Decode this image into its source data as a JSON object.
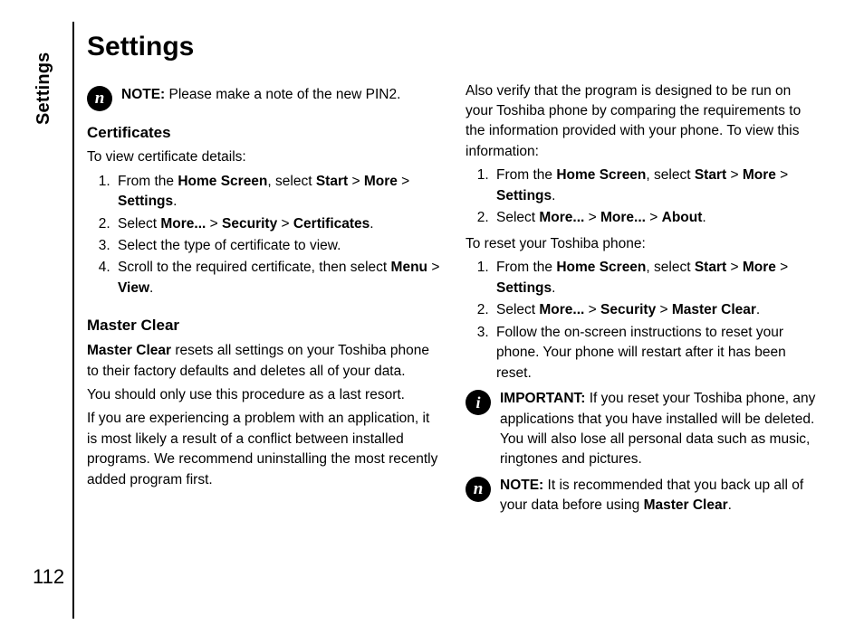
{
  "side_label": "Settings",
  "page_number": "112",
  "title": "Settings",
  "left": {
    "note1": {
      "label": "NOTE:",
      "text": " Please make a note of the new PIN2."
    },
    "certificates": {
      "heading": "Certificates",
      "intro": "To view certificate details:",
      "s1a": "From the ",
      "s1b": "Home Screen",
      "s1c": ", select ",
      "s1d": "Start",
      "s1e": " > ",
      "s1f": "More",
      "s1g": " > ",
      "s1h": "Settings",
      "s1i": ".",
      "s2a": "Select ",
      "s2b": "More...",
      "s2c": " > ",
      "s2d": "Security",
      "s2e": " > ",
      "s2f": "Certificates",
      "s2g": ".",
      "s3": "Select the type of certificate to view.",
      "s4a": "Scroll to the required certificate, then select ",
      "s4b": "Menu",
      "s4c": " > ",
      "s4d": "View",
      "s4e": "."
    },
    "master": {
      "heading": "Master Clear",
      "p1a": "Master Clear",
      "p1b": " resets all settings on your Toshiba phone to their factory defaults and deletes all of your data.",
      "p2": "You should only use this procedure as a last resort.",
      "p3": "If you are experiencing a problem with an application, it is most likely a result of a conflict between installed programs. We recommend uninstalling the most recently added program first."
    }
  },
  "right": {
    "p1": "Also verify that the program is designed to be run on your Toshiba phone by comparing the requirements to the information provided with your phone. To view this information:",
    "info_s1a": "From the ",
    "info_s1b": "Home Screen",
    "info_s1c": ", select ",
    "info_s1d": "Start",
    "info_s1e": " > ",
    "info_s1f": "More",
    "info_s1g": " > ",
    "info_s1h": "Settings",
    "info_s1i": ".",
    "info_s2a": "Select ",
    "info_s2b": "More...",
    "info_s2c": " > ",
    "info_s2d": "More...",
    "info_s2e": " > ",
    "info_s2f": "About",
    "info_s2g": ".",
    "reset_intro": "To reset your Toshiba phone:",
    "r1a": "From the ",
    "r1b": "Home Screen",
    "r1c": ", select ",
    "r1d": "Start",
    "r1e": " > ",
    "r1f": "More",
    "r1g": " > ",
    "r1h": "Settings",
    "r1i": ".",
    "r2a": "Select ",
    "r2b": "More...",
    "r2c": " > ",
    "r2d": "Security",
    "r2e": " > ",
    "r2f": "Master Clear",
    "r2g": ".",
    "r3": "Follow the on-screen instructions to reset your phone. Your phone will restart after it has been reset.",
    "important": {
      "label": "IMPORTANT:",
      "text": " If you reset your Toshiba phone, any applications that you have installed will be deleted. You will also lose all personal data such as music, ringtones and pictures."
    },
    "note2": {
      "label": "NOTE:",
      "text_a": " It is recommended that you back up all of your data before using ",
      "text_b": "Master Clear",
      "text_c": "."
    }
  },
  "icons": {
    "note_glyph": "n",
    "info_glyph": "i"
  }
}
